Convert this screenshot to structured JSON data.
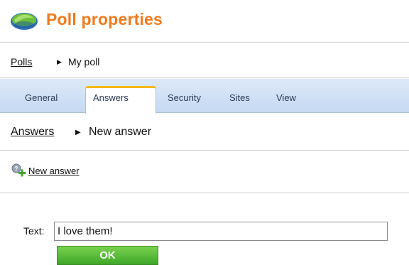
{
  "header": {
    "title": "Poll properties",
    "icon": "poll-icon"
  },
  "breadcrumb_top": {
    "link": "Polls",
    "separator": "▶",
    "current": "My poll"
  },
  "tabs": [
    {
      "label": "General",
      "active": false
    },
    {
      "label": "Answers",
      "active": true
    },
    {
      "label": "Security",
      "active": false
    },
    {
      "label": "Sites",
      "active": false
    },
    {
      "label": "View",
      "active": false
    }
  ],
  "breadcrumb_answers": {
    "link": "Answers",
    "separator": "▶",
    "current": "New answer"
  },
  "actions": {
    "new_answer_label": "New answer",
    "new_answer_icon": "add-answer-icon"
  },
  "form": {
    "text_label": "Text:",
    "text_value": "I love them!",
    "ok_label": "OK"
  },
  "colors": {
    "title": "#f07a1c",
    "tab_accent": "#f6b819",
    "tabs_bg": "#c5d9f2",
    "ok_button": "#4cae34"
  }
}
